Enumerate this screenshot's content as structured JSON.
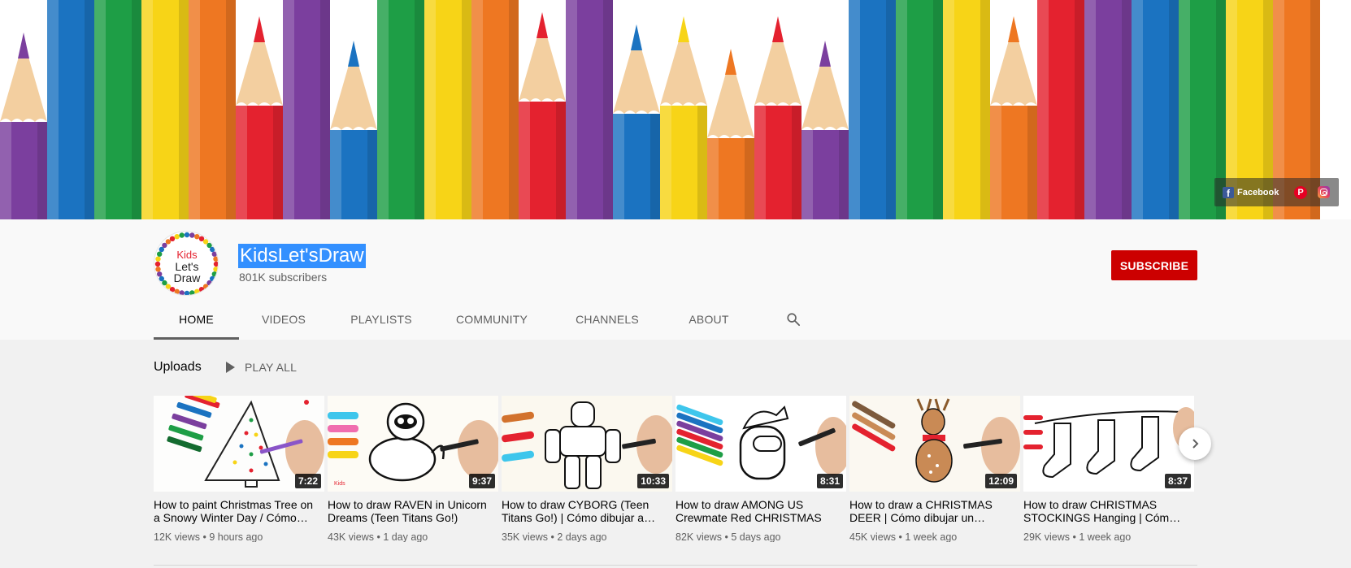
{
  "banner": {
    "pencil_colors": [
      "#7b3f9e",
      "#1b73c1",
      "#1e9e46",
      "#f7d417",
      "#ee7722",
      "#e4222f",
      "#7b3f9e",
      "#1b73c1",
      "#1e9e46",
      "#f7d417",
      "#ee7722",
      "#e4222f",
      "#7b3f9e",
      "#1b73c1",
      "#f7d417",
      "#ee7722",
      "#e4222f",
      "#7b3f9e",
      "#1b73c1",
      "#1e9e46",
      "#f7d417",
      "#ee7722",
      "#e4222f",
      "#7b3f9e",
      "#1b73c1",
      "#1e9e46",
      "#f7d417",
      "#ee7722"
    ],
    "social": {
      "facebook_label": "Facebook",
      "facebook_icon": "facebook-icon",
      "pinterest_icon": "pinterest-icon",
      "instagram_icon": "instagram-icon"
    }
  },
  "channel": {
    "avatar_lines": [
      "Kids",
      "Let's",
      "Draw"
    ],
    "name": "KidsLet'sDraw",
    "subscribers": "801K subscribers",
    "subscribe_label": "SUBSCRIBE"
  },
  "tabs": [
    {
      "label": "HOME",
      "active": true
    },
    {
      "label": "VIDEOS",
      "active": false
    },
    {
      "label": "PLAYLISTS",
      "active": false
    },
    {
      "label": "COMMUNITY",
      "active": false
    },
    {
      "label": "CHANNELS",
      "active": false
    },
    {
      "label": "ABOUT",
      "active": false
    }
  ],
  "uploads": {
    "title": "Uploads",
    "play_all_label": "PLAY ALL",
    "videos": [
      {
        "title": "How to paint Christmas Tree on a Snowy Winter Day / Cómo pintar",
        "duration": "7:22",
        "views": "12K views",
        "age": "9 hours ago"
      },
      {
        "title": "How to draw RAVEN in Unicorn Dreams (Teen Titans Go!)",
        "duration": "9:37",
        "views": "43K views",
        "age": "1 day ago"
      },
      {
        "title": "How to draw CYBORG (Teen Titans Go!) | Cómo dibujar a Cyborg",
        "duration": "10:33",
        "views": "35K views",
        "age": "2 days ago"
      },
      {
        "title": "How to draw AMONG US Crewmate Red CHRISTMAS",
        "duration": "8:31",
        "views": "82K views",
        "age": "5 days ago"
      },
      {
        "title": "How to draw a CHRISTMAS DEER | Cómo dibujar un venado",
        "duration": "12:09",
        "views": "45K views",
        "age": "1 week ago"
      },
      {
        "title": "How to draw CHRISTMAS STOCKINGS Hanging | Cómo dibujar",
        "duration": "8:37",
        "views": "29K views",
        "age": "1 week ago"
      }
    ]
  },
  "icons": {
    "search": "search-icon",
    "play": "play-icon",
    "next": "chevron-right-icon"
  },
  "colors": {
    "subscribe": "#cc0000",
    "selection": "#3390ff"
  }
}
